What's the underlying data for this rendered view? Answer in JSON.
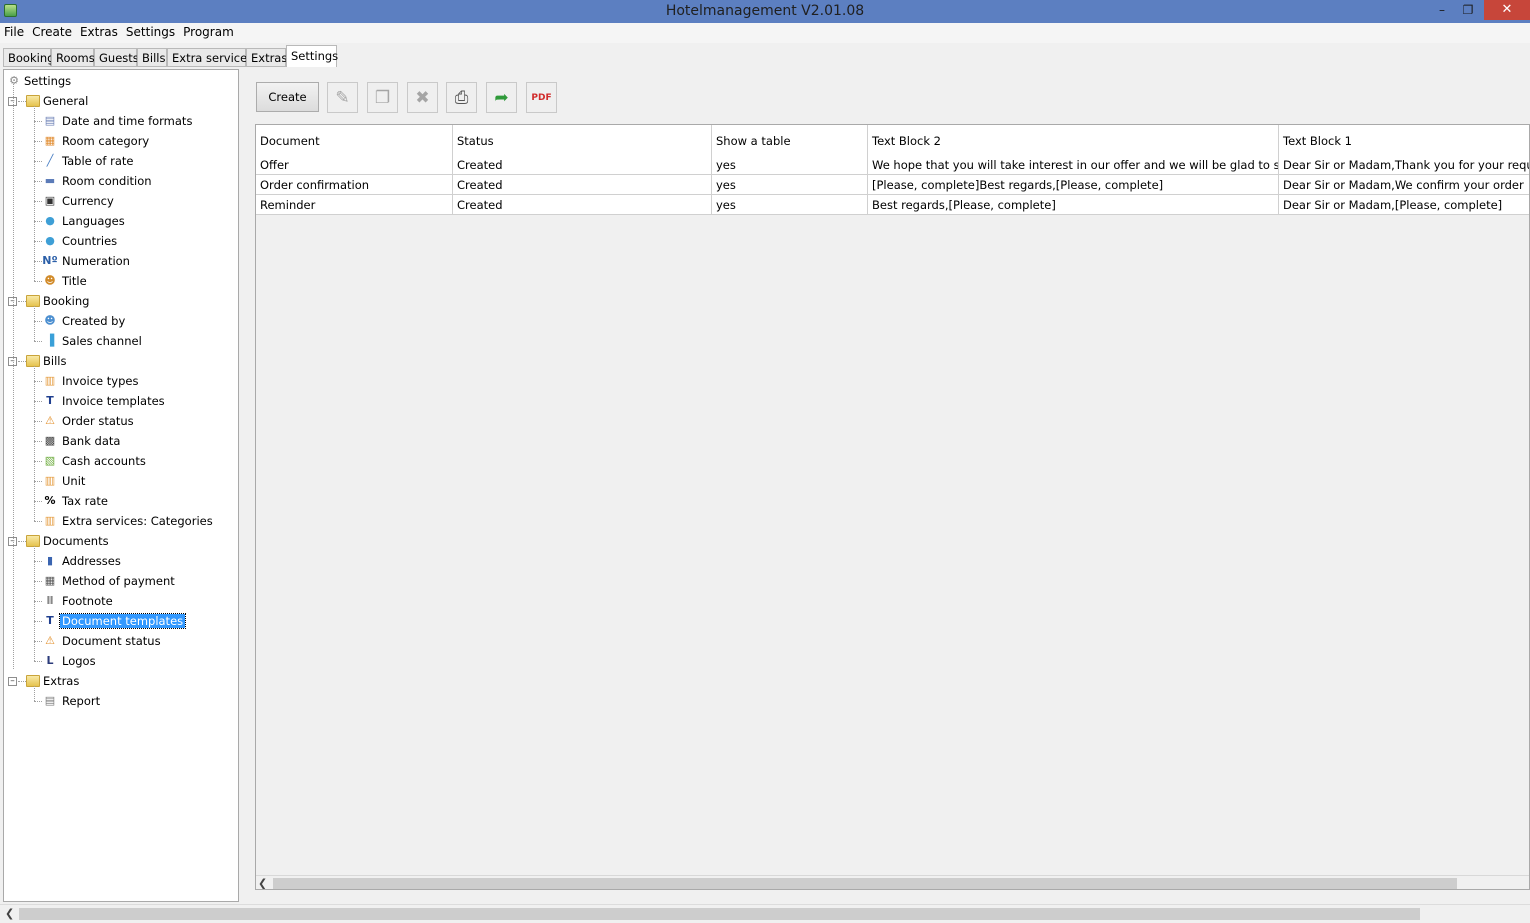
{
  "window": {
    "title": "Hotelmanagement V2.01.08",
    "minimize": "–",
    "maximize": "❐",
    "close": "✕"
  },
  "menu": [
    "File",
    "Create",
    "Extras",
    "Settings",
    "Program"
  ],
  "tabs": [
    "Booking",
    "Rooms",
    "Guests",
    "Bills",
    "Extra services",
    "Extras",
    "Settings"
  ],
  "active_tab": "Settings",
  "tree": {
    "root": "Settings",
    "groups": [
      {
        "label": "General",
        "items": [
          "Date and time formats",
          "Room category",
          "Table of rate",
          "Room condition",
          "Currency",
          "Languages",
          "Countries",
          "Numeration",
          "Title"
        ]
      },
      {
        "label": "Booking",
        "items": [
          "Created by",
          "Sales channel"
        ]
      },
      {
        "label": "Bills",
        "items": [
          "Invoice types",
          "Invoice templates",
          "Order status",
          "Bank data",
          "Cash accounts",
          "Unit",
          "Tax rate",
          "Extra services: Categories"
        ]
      },
      {
        "label": "Documents",
        "items": [
          "Addresses",
          "Method of payment",
          "Footnote",
          "Document templates",
          "Document status",
          "Logos"
        ]
      },
      {
        "label": "Extras",
        "items": [
          "Report"
        ]
      }
    ],
    "selected": "Document templates",
    "item_icons": {
      "Date and time formats": "calendar-icon",
      "Room category": "room-category-icon",
      "Table of rate": "chart-icon",
      "Room condition": "bed-icon",
      "Currency": "money-icon",
      "Languages": "globe-icon",
      "Countries": "globe-icon",
      "Numeration": "numero-icon",
      "Title": "person-icon",
      "Created by": "users-icon",
      "Sales channel": "bar-chart-icon",
      "Invoice types": "document-icon",
      "Invoice templates": "template-icon",
      "Order status": "warning-icon",
      "Bank data": "bank-icon",
      "Cash accounts": "cash-icon",
      "Unit": "document-icon",
      "Tax rate": "percent-icon",
      "Extra services: Categories": "document-icon",
      "Addresses": "address-book-icon",
      "Method of payment": "payment-icon",
      "Footnote": "footnote-icon",
      "Document templates": "template-icon",
      "Document status": "warning-icon",
      "Logos": "logo-icon",
      "Report": "report-icon"
    }
  },
  "toolbar": {
    "create_label": "Create",
    "tools": [
      {
        "name": "edit-icon",
        "glyph": "✎",
        "enabled": false
      },
      {
        "name": "copy-icon",
        "glyph": "❐",
        "enabled": false
      },
      {
        "name": "delete-icon",
        "glyph": "✖",
        "enabled": false
      },
      {
        "name": "print-icon",
        "glyph": "⎙",
        "enabled": true
      },
      {
        "name": "export-icon",
        "glyph": "➦",
        "enabled": true
      },
      {
        "name": "pdf-icon",
        "glyph": "PDF",
        "enabled": true
      }
    ]
  },
  "table": {
    "columns": [
      "Document",
      "Status",
      "Show a table",
      "Text Block 2",
      "Text Block 1"
    ],
    "rows": [
      [
        "Offer",
        "Created",
        "yes",
        "We hope that you will take interest in our offer and we will be glad to send you t...",
        "Dear Sir or Madam,Thank you for your request. We"
      ],
      [
        "Order confirmation",
        "Created",
        "yes",
        "[Please, complete]Best regards,[Please, complete]",
        "Dear Sir or Madam,We confirm your order"
      ],
      [
        "Reminder",
        "Created",
        "yes",
        "Best regards,[Please, complete]",
        "Dear Sir or Madam,[Please, complete]"
      ]
    ]
  },
  "colors": {
    "titlebar": "#5c7fc1",
    "close_button": "#c7463a",
    "selection": "#3399ff"
  }
}
